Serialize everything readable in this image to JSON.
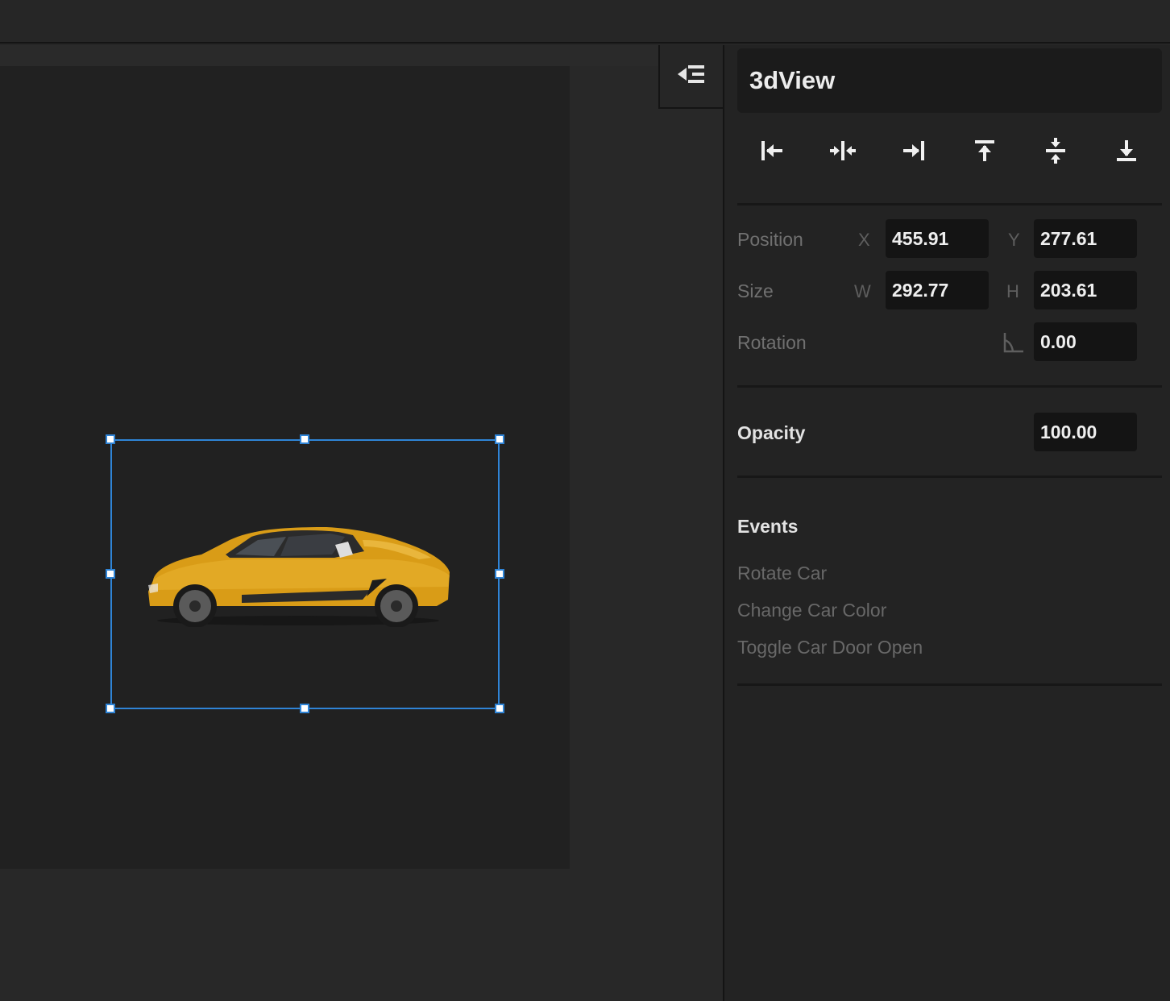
{
  "panel": {
    "component_name": "3dView",
    "align_buttons": [
      {
        "icon": "align-left-icon"
      },
      {
        "icon": "align-horizontal-center-icon"
      },
      {
        "icon": "align-right-icon"
      },
      {
        "icon": "align-top-icon"
      },
      {
        "icon": "align-vertical-center-icon"
      },
      {
        "icon": "align-bottom-icon"
      }
    ],
    "position": {
      "label": "Position",
      "x_label": "X",
      "x_value": "455.91",
      "y_label": "Y",
      "y_value": "277.61"
    },
    "size": {
      "label": "Size",
      "w_label": "W",
      "w_value": "292.77",
      "h_label": "H",
      "h_value": "203.61"
    },
    "rotation": {
      "label": "Rotation",
      "icon": "angle-icon",
      "value": "0.00"
    },
    "opacity": {
      "label": "Opacity",
      "value": "100.00"
    },
    "events": {
      "title": "Events",
      "items": [
        "Rotate Car",
        "Change Car Color",
        "Toggle Car Door Open"
      ]
    }
  },
  "canvas": {
    "selected_object": "sports-car-3d-model",
    "car_color": "#e0a21f",
    "selection_color": "#2f84d6"
  },
  "colors": {
    "panel_bg": "#232323",
    "field_bg": "#141414",
    "accent": "#2f84d6"
  }
}
